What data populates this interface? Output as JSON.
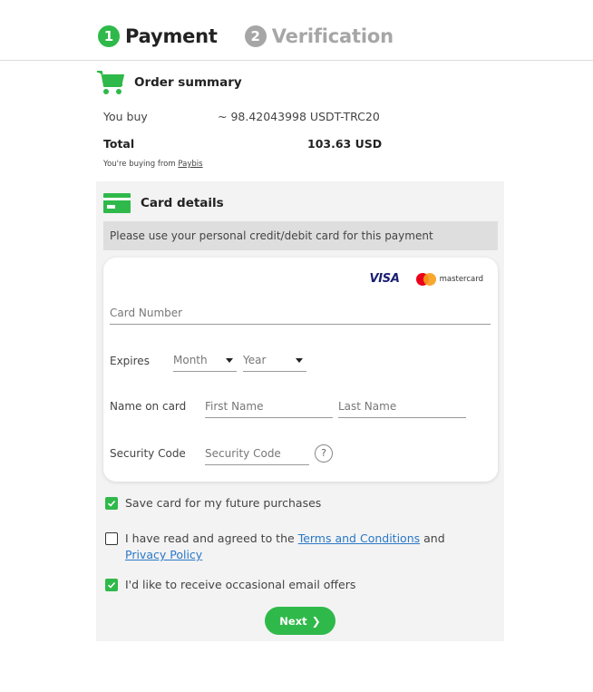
{
  "steps": [
    {
      "number": "1",
      "label": "Payment",
      "state": "active"
    },
    {
      "number": "2",
      "label": "Verification",
      "state": "inactive"
    }
  ],
  "order_summary": {
    "title": "Order summary",
    "you_buy_label": "You buy",
    "you_buy_value": "~ 98.42043998 USDT-TRC20",
    "total_label": "Total",
    "total_value": "103.63 USD",
    "buying_from_prefix": "You're buying from",
    "buying_from_link": "Paybis"
  },
  "card_details": {
    "title": "Card details",
    "notice": "Please use your personal credit/debit card for this payment",
    "brands": {
      "visa": "VISA",
      "mastercard": "mastercard"
    },
    "card_number_placeholder": "Card Number",
    "expires_label": "Expires",
    "month_placeholder": "Month",
    "year_placeholder": "Year",
    "name_label": "Name on card",
    "first_name_placeholder": "First Name",
    "last_name_placeholder": "Last Name",
    "security_label": "Security Code",
    "security_placeholder": "Security Code",
    "help_glyph": "?"
  },
  "checkboxes": {
    "save_card": {
      "label": "Save card for my future purchases",
      "checked": true
    },
    "terms": {
      "prefix": "I have read and agreed to the",
      "terms_link": "Terms and Conditions",
      "and": "and",
      "privacy_link": "Privacy Policy",
      "checked": false
    },
    "email_offers": {
      "label": "I'd like to receive occasional email offers",
      "checked": true
    }
  },
  "next_button": {
    "label": "Next",
    "chevron": "❯"
  },
  "colors": {
    "accent": "#2fb94a",
    "link": "#2a78c7",
    "panel": "#f3f3f3"
  }
}
